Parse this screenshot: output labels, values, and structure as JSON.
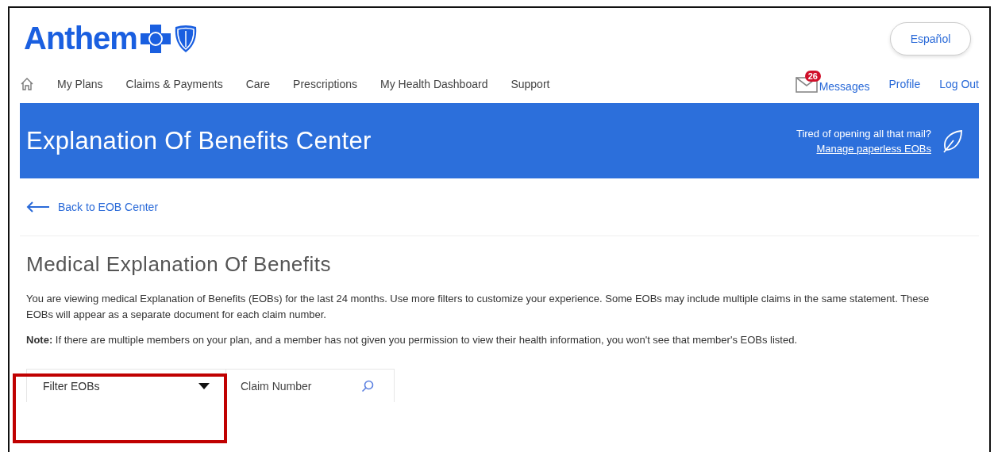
{
  "header": {
    "logo_text": "Anthem",
    "language_button": "Español"
  },
  "nav": {
    "items": [
      {
        "label": "My Plans"
      },
      {
        "label": "Claims & Payments"
      },
      {
        "label": "Care"
      },
      {
        "label": "Prescriptions"
      },
      {
        "label": "My Health Dashboard"
      },
      {
        "label": "Support"
      }
    ],
    "messages": {
      "label": "Messages",
      "badge": "26"
    },
    "links": [
      "Profile",
      "Log Out"
    ]
  },
  "banner": {
    "title": "Explanation Of Benefits Center",
    "promo": "Tired of opening all that mail?",
    "promo_link": "Manage paperless EOBs"
  },
  "back_link": "Back to EOB Center",
  "page": {
    "heading": "Medical Explanation Of Benefits",
    "intro": "You are viewing medical Explanation of Benefits (EOBs) for the last 24 months. Use more filters to customize your experience. Some EOBs may include multiple claims in the same statement. These EOBs will appear as a separate document for each claim number.",
    "note": "**Note:** If there are multiple members on your plan, and a member has not given you permission to view their health information, you won't see that member's EOBs listed."
  },
  "filters": {
    "dropdown": "Filter EOBs",
    "search_placeholder": "Claim Number",
    "highlighted": true
  }
}
